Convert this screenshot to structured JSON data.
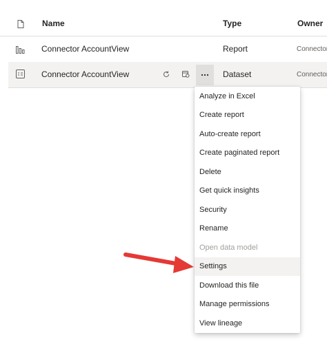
{
  "table": {
    "headers": {
      "name": "Name",
      "type": "Type",
      "owner": "Owner"
    },
    "rows": [
      {
        "name": "Connector AccountView",
        "type": "Report",
        "owner": "Connector",
        "icon": "report-bar-chart-icon"
      },
      {
        "name": "Connector AccountView",
        "type": "Dataset",
        "owner": "Connector",
        "icon": "dataset-icon"
      }
    ]
  },
  "menu": {
    "items": [
      {
        "label": "Analyze in Excel",
        "state": "normal"
      },
      {
        "label": "Create report",
        "state": "normal"
      },
      {
        "label": "Auto-create report",
        "state": "normal"
      },
      {
        "label": "Create paginated report",
        "state": "normal"
      },
      {
        "label": "Delete",
        "state": "normal"
      },
      {
        "label": "Get quick insights",
        "state": "normal"
      },
      {
        "label": "Security",
        "state": "normal"
      },
      {
        "label": "Rename",
        "state": "normal"
      },
      {
        "label": "Open data model",
        "state": "disabled"
      },
      {
        "label": "Settings",
        "state": "highlighted"
      },
      {
        "label": "Download this file",
        "state": "normal"
      },
      {
        "label": "Manage permissions",
        "state": "normal"
      },
      {
        "label": "View lineage",
        "state": "normal"
      }
    ]
  },
  "colors": {
    "annotation_arrow": "#e53935",
    "hover_bg": "#f3f2f1",
    "more_button_bg": "#e1dfdd",
    "disabled_text": "#a19f9d"
  }
}
